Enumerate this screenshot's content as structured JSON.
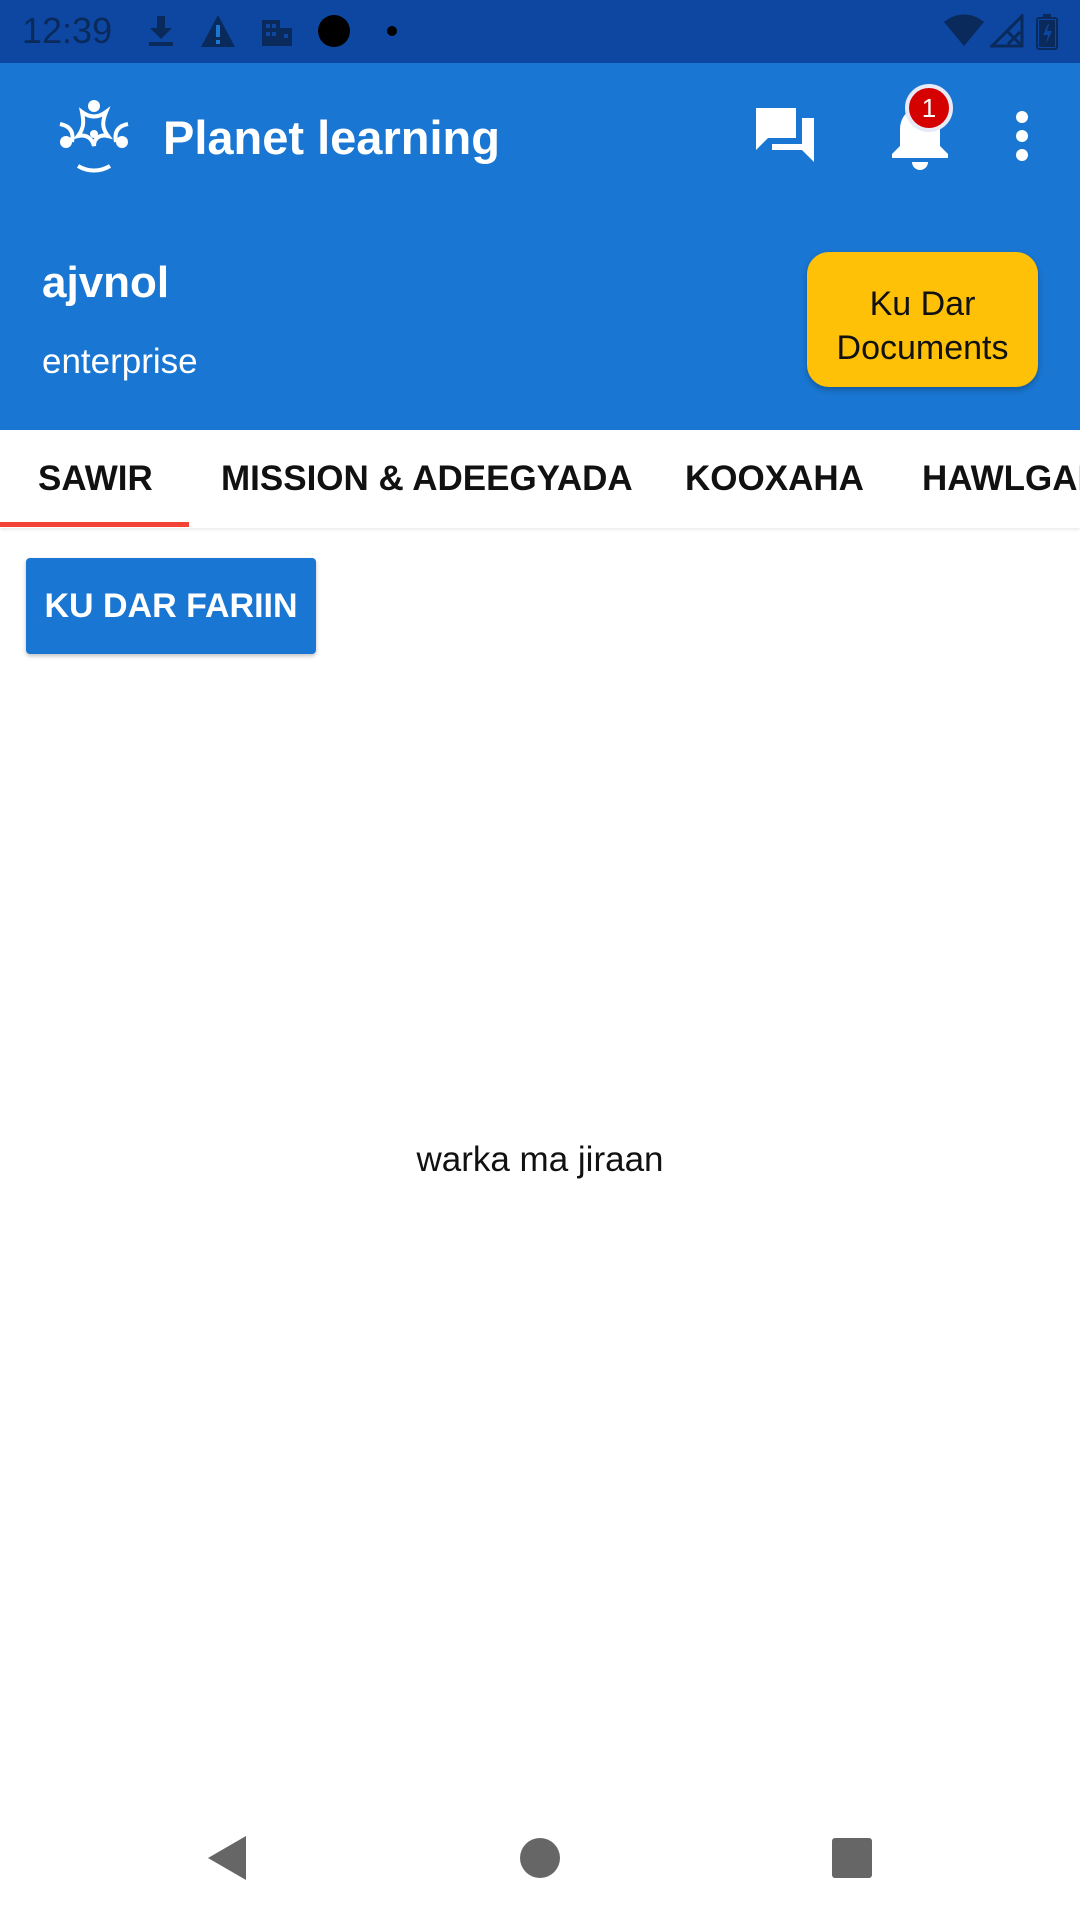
{
  "status_bar": {
    "time": "12:39",
    "icons": [
      "download-icon",
      "warning-icon",
      "building-icon",
      "dot-icon",
      "small-dot-icon",
      "wifi-icon",
      "signal-icon",
      "battery-icon"
    ]
  },
  "app_bar": {
    "title": "Planet learning",
    "notification_count": "1",
    "icons": [
      "logo-icon",
      "chat-icon",
      "bell-icon",
      "more-vert-icon"
    ]
  },
  "profile": {
    "name": "ajvnol",
    "type": "enterprise",
    "docs_button_line1": "Ku Dar",
    "docs_button_line2": "Documents"
  },
  "tabs": [
    {
      "label": "SAWIR",
      "selected": true
    },
    {
      "label": "MISSION & ADEEGYADA",
      "selected": false
    },
    {
      "label": "KOOXAHA",
      "selected": false
    },
    {
      "label": "HAWLGAL",
      "selected": false
    }
  ],
  "content": {
    "add_button": "KU DAR FARIIN",
    "empty_message": "warka ma jiraan"
  },
  "colors": {
    "primary": "#1976d2",
    "status_bar": "#0d47a1",
    "accent": "#ffc107",
    "tab_indicator": "#f44336",
    "badge": "#d50000"
  }
}
